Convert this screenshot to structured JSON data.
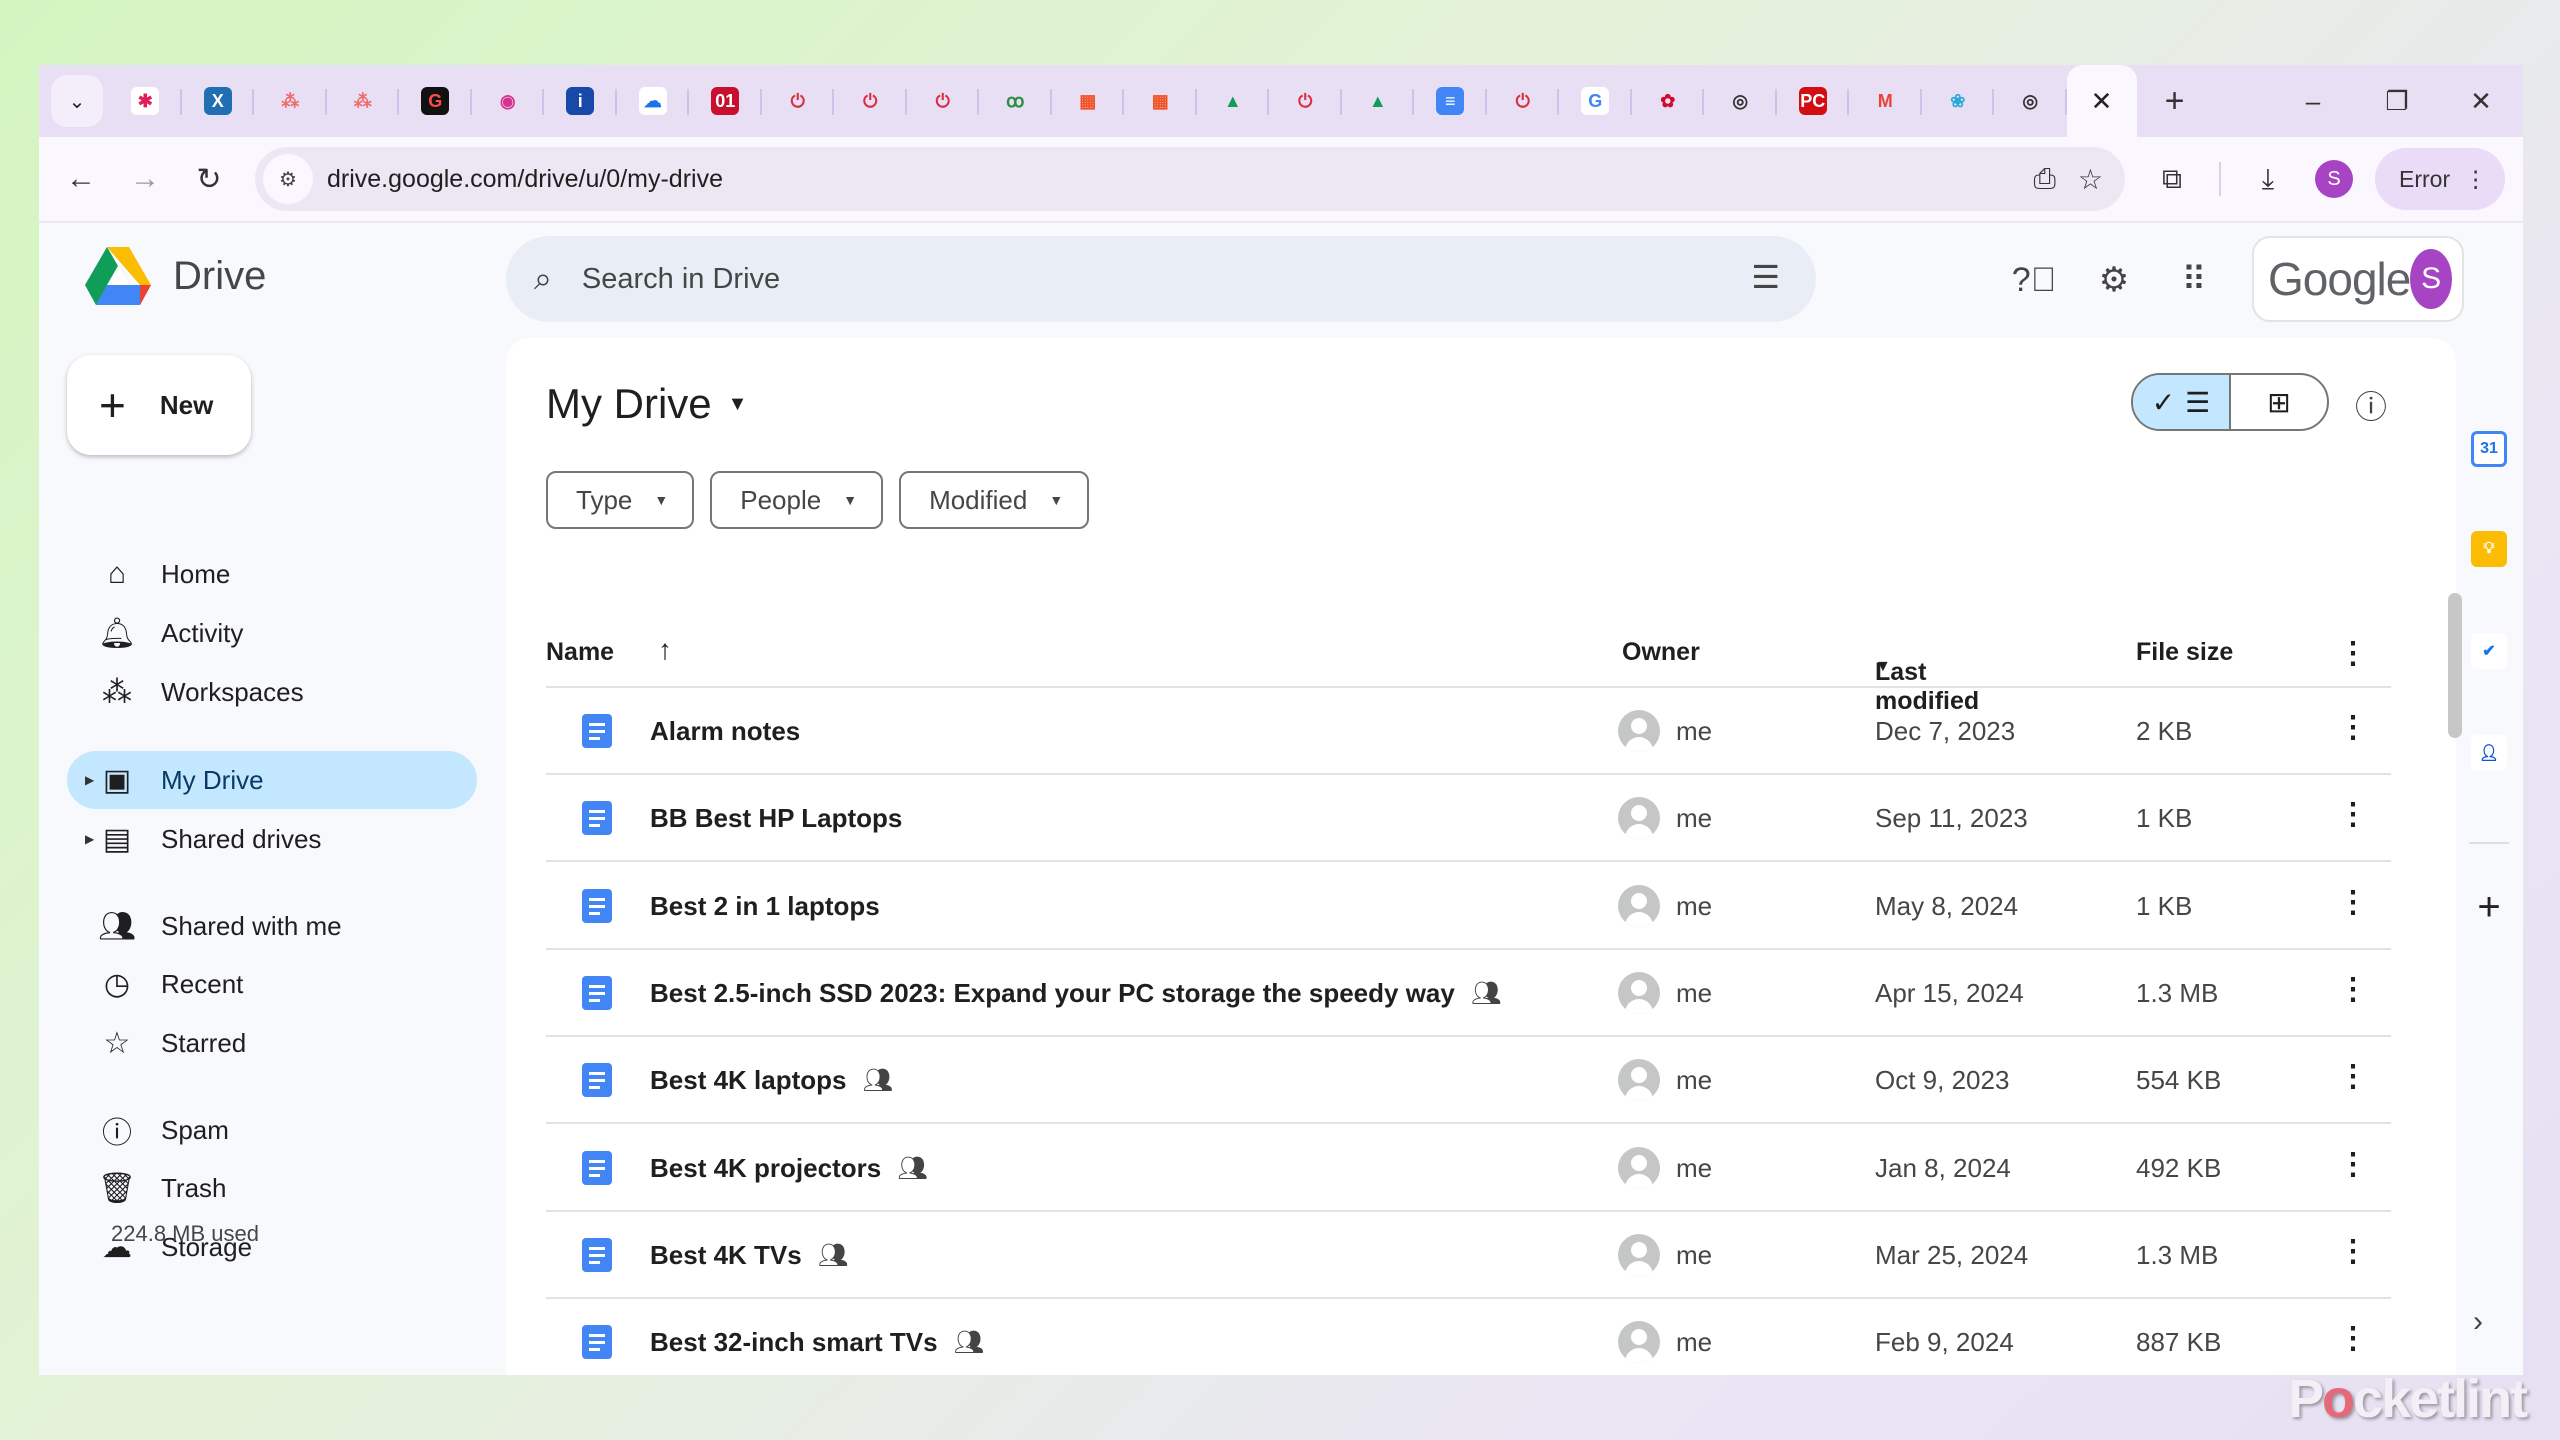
{
  "browser": {
    "tab_favicons": [
      {
        "name": "slack-favicon",
        "glyph": "✱",
        "bg": "#ffffff",
        "fg": "#e01e5a"
      },
      {
        "name": "xbox-favicon",
        "glyph": "X",
        "bg": "#1f6fb2",
        "fg": "#ffffff"
      },
      {
        "name": "asana-favicon",
        "glyph": "⁂",
        "bg": "transparent",
        "fg": "#f06a6a"
      },
      {
        "name": "asana-favicon",
        "glyph": "⁂",
        "bg": "transparent",
        "fg": "#f06a6a"
      },
      {
        "name": "gizmodo-favicon",
        "glyph": "G",
        "bg": "#111111",
        "fg": "#ff4a4a"
      },
      {
        "name": "rss-favicon",
        "glyph": "◉",
        "bg": "transparent",
        "fg": "#d6338f"
      },
      {
        "name": "info-favicon",
        "glyph": "i",
        "bg": "#1849a9",
        "fg": "#ffffff"
      },
      {
        "name": "cloud-favicon",
        "glyph": "☁",
        "bg": "#ffffff",
        "fg": "#1a73e8"
      },
      {
        "name": "o1-favicon",
        "glyph": "01",
        "bg": "#c8102e",
        "fg": "#ffffff"
      },
      {
        "name": "pocketlint-favicon",
        "glyph": "⏻",
        "bg": "transparent",
        "fg": "#d93040"
      },
      {
        "name": "pocketlint-favicon",
        "glyph": "⏻",
        "bg": "transparent",
        "fg": "#d93040"
      },
      {
        "name": "pocketlint-favicon",
        "glyph": "⏻",
        "bg": "transparent",
        "fg": "#d93040"
      },
      {
        "name": "geeksforgeeks-favicon",
        "glyph": "ꝏ",
        "bg": "transparent",
        "fg": "#2f8d46"
      },
      {
        "name": "microsoft-favicon",
        "glyph": "▦",
        "bg": "transparent",
        "fg": "#f25022"
      },
      {
        "name": "microsoft-favicon",
        "glyph": "▦",
        "bg": "transparent",
        "fg": "#f25022"
      },
      {
        "name": "drive-favicon",
        "glyph": "▲",
        "bg": "transparent",
        "fg": "#0f9d58"
      },
      {
        "name": "pocketlint-favicon",
        "glyph": "⏻",
        "bg": "transparent",
        "fg": "#d93040"
      },
      {
        "name": "drive-favicon",
        "glyph": "▲",
        "bg": "transparent",
        "fg": "#0f9d58"
      },
      {
        "name": "docs-favicon",
        "glyph": "≡",
        "bg": "#4285f4",
        "fg": "#ffffff"
      },
      {
        "name": "pocketlint-favicon",
        "glyph": "⏻",
        "bg": "transparent",
        "fg": "#d93040"
      },
      {
        "name": "google-favicon",
        "glyph": "G",
        "bg": "#ffffff",
        "fg": "#4285f4"
      },
      {
        "name": "huawei-favicon",
        "glyph": "✿",
        "bg": "transparent",
        "fg": "#cf0a2c"
      },
      {
        "name": "chrome-favicon",
        "glyph": "◎",
        "bg": "transparent",
        "fg": "#333333"
      },
      {
        "name": "pcmag-favicon",
        "glyph": "PC",
        "bg": "#d40d12",
        "fg": "#ffffff"
      },
      {
        "name": "gmail-favicon",
        "glyph": "M",
        "bg": "transparent",
        "fg": "#ea4335"
      },
      {
        "name": "flower-favicon",
        "glyph": "❀",
        "bg": "transparent",
        "fg": "#2aa8d8"
      },
      {
        "name": "chrome-favicon",
        "glyph": "◎",
        "bg": "transparent",
        "fg": "#333333"
      }
    ],
    "active_tab_close": "✕",
    "new_tab": "+",
    "tab_search": "⌄",
    "window_controls": {
      "minimize": "–",
      "restore": "❐",
      "close": "✕"
    },
    "nav": {
      "back": "←",
      "forward": "→",
      "reload": "↻"
    },
    "url": "drive.google.com/drive/u/0/my-drive",
    "profile_initial": "S",
    "error_label": "Error"
  },
  "app": {
    "name": "Drive",
    "search_placeholder": "Search in Drive",
    "account_brand": "Google",
    "account_initial": "S",
    "new_button": "New",
    "sidebar": {
      "items": [
        {
          "label": "Home",
          "icon": "⌂",
          "name": "home"
        },
        {
          "label": "Activity",
          "icon": "🔔︎",
          "name": "activity"
        },
        {
          "label": "Workspaces",
          "icon": "⁂",
          "name": "workspaces"
        },
        {
          "label": "My Drive",
          "icon": "▣",
          "name": "my-drive",
          "active": true,
          "expandable": true
        },
        {
          "label": "Shared drives",
          "icon": "▤",
          "name": "shared-drives",
          "expandable": true
        },
        {
          "label": "Shared with me",
          "icon": "👥︎",
          "name": "shared-with-me"
        },
        {
          "label": "Recent",
          "icon": "◷",
          "name": "recent"
        },
        {
          "label": "Starred",
          "icon": "☆",
          "name": "starred"
        },
        {
          "label": "Spam",
          "icon": "ⓘ",
          "name": "spam"
        },
        {
          "label": "Trash",
          "icon": "🗑︎",
          "name": "trash"
        },
        {
          "label": "Storage",
          "icon": "☁",
          "name": "storage"
        }
      ],
      "storage_used": "224.8 MB used"
    },
    "main": {
      "title": "My Drive",
      "filters": [
        "Type",
        "People",
        "Modified"
      ],
      "columns": {
        "name": "Name",
        "owner": "Owner",
        "last_modified": "Last modified",
        "file_size": "File size"
      },
      "sort_name_icon": "↑",
      "files": [
        {
          "name": "Alarm notes",
          "shared": false,
          "owner": "me",
          "modified": "Dec 7, 2023",
          "size": "2 KB"
        },
        {
          "name": "BB Best HP Laptops",
          "shared": false,
          "owner": "me",
          "modified": "Sep 11, 2023",
          "size": "1 KB"
        },
        {
          "name": "Best 2 in 1 laptops",
          "shared": false,
          "owner": "me",
          "modified": "May 8, 2024",
          "size": "1 KB"
        },
        {
          "name": "Best 2.5-inch SSD 2023: Expand your PC storage the speedy way",
          "shared": true,
          "owner": "me",
          "modified": "Apr 15, 2024",
          "size": "1.3 MB"
        },
        {
          "name": "Best 4K laptops",
          "shared": true,
          "owner": "me",
          "modified": "Oct 9, 2023",
          "size": "554 KB"
        },
        {
          "name": "Best 4K projectors",
          "shared": true,
          "owner": "me",
          "modified": "Jan 8, 2024",
          "size": "492 KB"
        },
        {
          "name": "Best 4K TVs",
          "shared": true,
          "owner": "me",
          "modified": "Mar 25, 2024",
          "size": "1.3 MB"
        },
        {
          "name": "Best 32-inch smart TVs",
          "shared": true,
          "owner": "me",
          "modified": "Feb 9, 2024",
          "size": "887 KB"
        }
      ]
    },
    "side_panel": {
      "apps": [
        {
          "name": "calendar",
          "glyph": "31",
          "bg": "#ffffff",
          "fg": "#1a73e8",
          "border": "#4285f4"
        },
        {
          "name": "keep",
          "glyph": "💡︎",
          "bg": "#fbbc04",
          "fg": "#ffffff",
          "border": "#fbbc04"
        },
        {
          "name": "tasks",
          "glyph": "✔",
          "bg": "#ffffff",
          "fg": "#1a73e8",
          "border": "#ffffff"
        },
        {
          "name": "contacts",
          "glyph": "👤︎",
          "bg": "#ffffff",
          "fg": "#0b57d0",
          "border": "#ffffff"
        }
      ],
      "add": "+",
      "expand": "›"
    },
    "colors": {
      "accent": "#c2e7ff",
      "docs_blue": "#4285f4",
      "avatar_purple": "#a744c4"
    }
  },
  "watermark": {
    "prefix": "P",
    "o": "o",
    "suffix": "cketlint"
  }
}
